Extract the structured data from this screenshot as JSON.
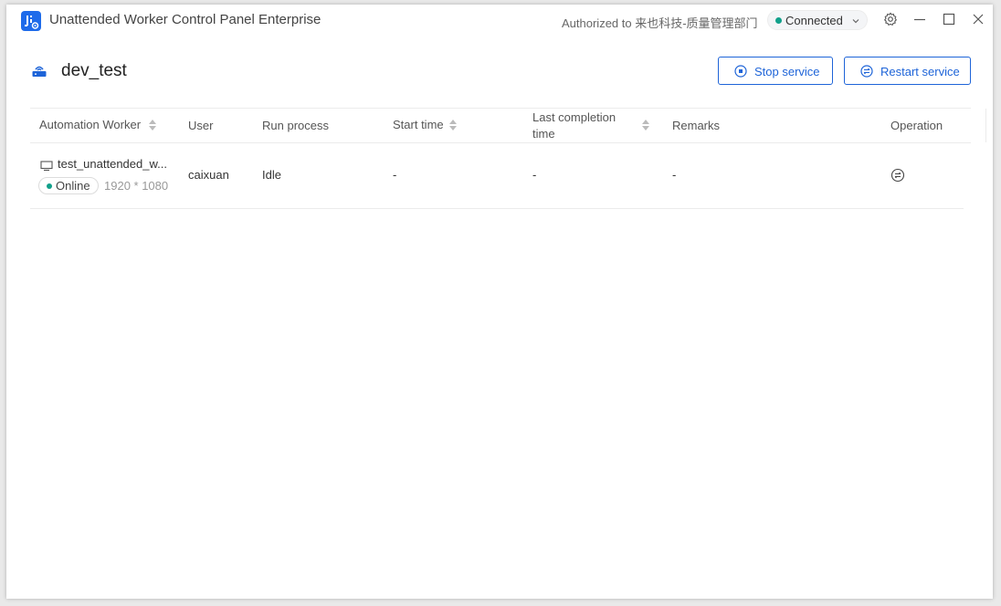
{
  "window": {
    "title": "Unattended Worker Control Panel Enterprise",
    "authorized": "Authorized to 来也科技-质量管理部门",
    "connection": {
      "label": "Connected",
      "color": "#11a08a"
    }
  },
  "header": {
    "title": "dev_test",
    "stop_label": "Stop service",
    "restart_label": "Restart service"
  },
  "table": {
    "columns": {
      "worker": "Automation Worker",
      "user": "User",
      "process": "Run process",
      "start": "Start time",
      "last_line1": "Last completion",
      "last_line2": "time",
      "remarks": "Remarks",
      "operation": "Operation"
    },
    "rows": [
      {
        "worker": "test_unattended_w...",
        "status": "Online",
        "resolution": "1920 * 1080",
        "user": "caixuan",
        "process": "Idle",
        "start": "-",
        "last": "-",
        "remarks": "-"
      }
    ]
  },
  "colors": {
    "accent": "#1e64d8",
    "online": "#11a08a"
  },
  "icons": {
    "logo": "robot-app-logo-icon",
    "env": "router-icon",
    "settings": "gear-icon",
    "monitor": "monitor-icon",
    "stop": "stop-circle-icon",
    "restart": "restart-icon",
    "operation": "operation-menu-icon"
  }
}
